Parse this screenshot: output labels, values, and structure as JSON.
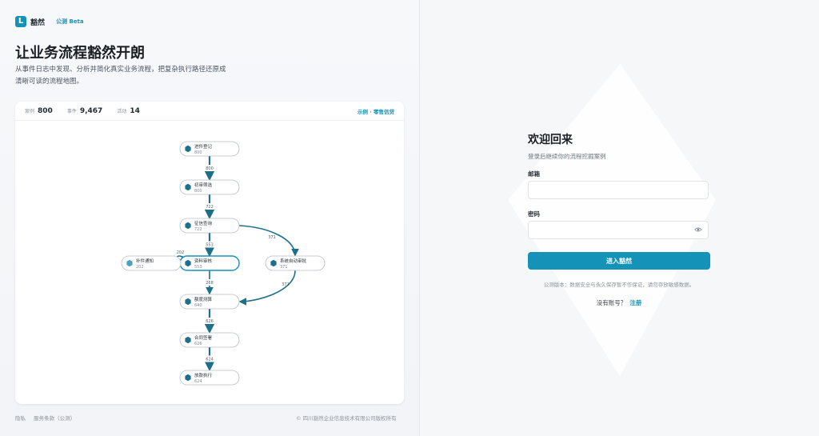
{
  "brand": {
    "logo_glyph": "L",
    "name": "豁然",
    "beta_label": "公测 Beta"
  },
  "hero": {
    "title": "让业务流程豁然开朗",
    "description": "从事件日志中发现、分析并简化真实业务流程，把复杂执行路径还原成清晰可读的流程地图。"
  },
  "card": {
    "stats": [
      {
        "label": "案例",
        "value": "800"
      },
      {
        "label": "事件",
        "value": "9,467"
      },
      {
        "label": "活动",
        "value": "14"
      }
    ],
    "example_label": "示例 · 零售信贷"
  },
  "flow": {
    "nodes": [
      {
        "id": "n1",
        "label": "进件登记",
        "count": "800"
      },
      {
        "id": "n2",
        "label": "初审筛选",
        "count": "800"
      },
      {
        "id": "n3",
        "label": "征信查询",
        "count": "722"
      },
      {
        "id": "n4",
        "label": "资料审核",
        "count": "553"
      },
      {
        "id": "n5",
        "label": "补件通知",
        "count": "202"
      },
      {
        "id": "n6",
        "label": "系统自动审批",
        "count": "371"
      },
      {
        "id": "n7",
        "label": "额度测算",
        "count": "640"
      },
      {
        "id": "n8",
        "label": "合同签署",
        "count": "626"
      },
      {
        "id": "n9",
        "label": "放款执行",
        "count": "624"
      }
    ],
    "edges": [
      {
        "from": "n1",
        "to": "n2",
        "label": "800"
      },
      {
        "from": "n2",
        "to": "n3",
        "label": "722"
      },
      {
        "from": "n3",
        "to": "n4",
        "label": "553"
      },
      {
        "from": "n4",
        "to": "n5",
        "label": "202"
      },
      {
        "from": "n3",
        "to": "n6",
        "label": "371"
      },
      {
        "from": "n6",
        "to": "n7",
        "label": "371"
      },
      {
        "from": "n4",
        "to": "n7",
        "label": "268"
      },
      {
        "from": "n7",
        "to": "n8",
        "label": "626"
      },
      {
        "from": "n8",
        "to": "n9",
        "label": "624"
      }
    ]
  },
  "footer": {
    "links": [
      "隐私",
      "服务条款（公测）"
    ],
    "copyright": "© 四川豁然企业信息技术有限公司版权所有"
  },
  "login": {
    "title": "欢迎回来",
    "subtitle": "登录后继续你的流程挖掘案例",
    "email_label": "邮箱",
    "email_value": "",
    "password_label": "密码",
    "password_value": "",
    "submit_label": "进入豁然",
    "notice": "公测版本：数据安全与永久保存暂不作保证，请勿存放敏感数据。",
    "register_prompt": "没有账号？",
    "register_link": "注册"
  },
  "colors": {
    "accent": "#1592b8",
    "node_icon": "#1e6f8a",
    "text": "#1f2933"
  },
  "icons": {
    "logo": "logo-icon",
    "node": "hexagon-icon",
    "eye": "eye-icon"
  }
}
